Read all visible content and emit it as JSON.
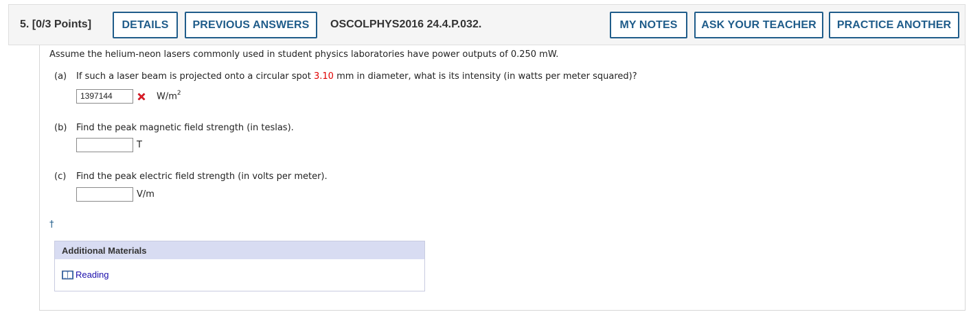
{
  "header": {
    "question_number": "5.",
    "points": "[0/3 Points]",
    "details_label": "DETAILS",
    "previous_answers_label": "PREVIOUS ANSWERS",
    "question_code": "OSCOLPHYS2016 24.4.P.032.",
    "my_notes_label": "MY NOTES",
    "ask_teacher_label": "ASK YOUR TEACHER",
    "practice_another_label": "PRACTICE ANOTHER"
  },
  "question": {
    "stem": "Assume the helium-neon lasers commonly used in student physics laboratories have power outputs of 0.250 mW.",
    "parts": [
      {
        "label": "(a)",
        "text_before": "If such a laser beam is projected onto a circular spot ",
        "highlight": "3.10",
        "text_after": " mm in diameter, what is its intensity (in watts per meter squared)?",
        "answer_value": "1397144",
        "unit": "W/m",
        "unit_sup": "2",
        "status": "incorrect"
      },
      {
        "label": "(b)",
        "text": "Find the peak magnetic field strength (in teslas).",
        "answer_value": "",
        "unit": "T"
      },
      {
        "label": "(c)",
        "text": "Find the peak electric field strength (in volts per meter).",
        "answer_value": "",
        "unit": "V/m"
      }
    ]
  },
  "footnote_marker": "†",
  "additional_materials": {
    "title": "Additional Materials",
    "links": [
      {
        "label": "Reading",
        "icon": "book-icon"
      }
    ]
  },
  "colors": {
    "button_border": "#1f5c8a",
    "highlight_red": "#e00000",
    "materials_header": "#d8dcf2",
    "link": "#1a0dab"
  }
}
